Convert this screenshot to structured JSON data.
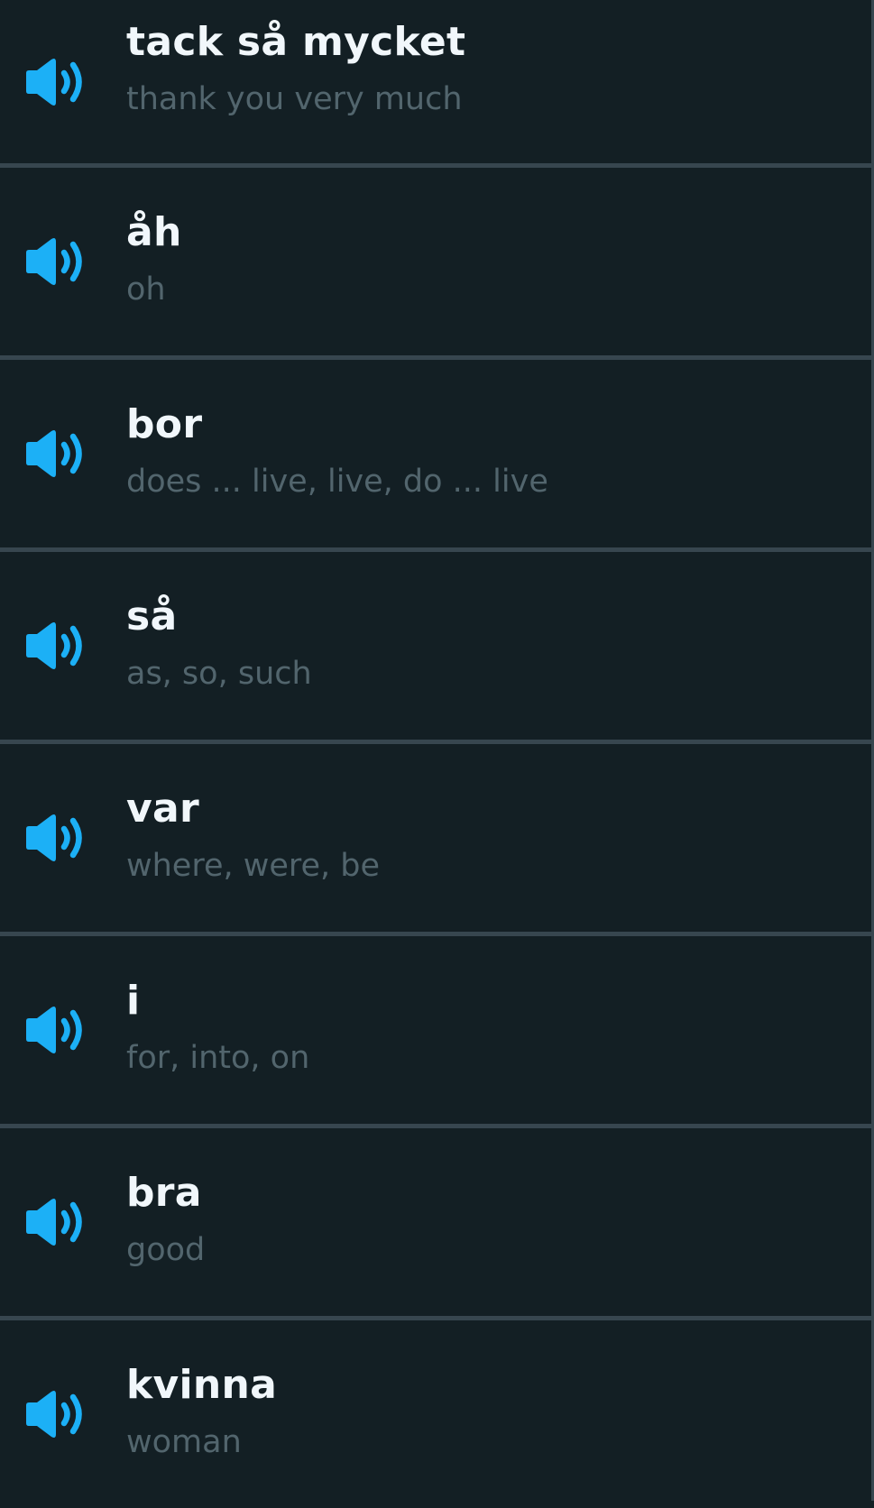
{
  "colors": {
    "background": "#131f24",
    "divider": "#37464f",
    "term_text": "#f1f7fb",
    "translation_text": "#52656d",
    "speaker_icon": "#1cb0f6"
  },
  "words": [
    {
      "term": "tack så mycket",
      "translation": "thank you very much",
      "icon": "speaker-icon"
    },
    {
      "term": "åh",
      "translation": "oh",
      "icon": "speaker-icon"
    },
    {
      "term": "bor",
      "translation": "does ... live, live, do ... live",
      "icon": "speaker-icon"
    },
    {
      "term": "så",
      "translation": "as, so, such",
      "icon": "speaker-icon"
    },
    {
      "term": "var",
      "translation": "where, were, be",
      "icon": "speaker-icon"
    },
    {
      "term": "i",
      "translation": "for, into, on",
      "icon": "speaker-icon"
    },
    {
      "term": "bra",
      "translation": "good",
      "icon": "speaker-icon"
    },
    {
      "term": "kvinna",
      "translation": "woman",
      "icon": "speaker-icon"
    }
  ]
}
